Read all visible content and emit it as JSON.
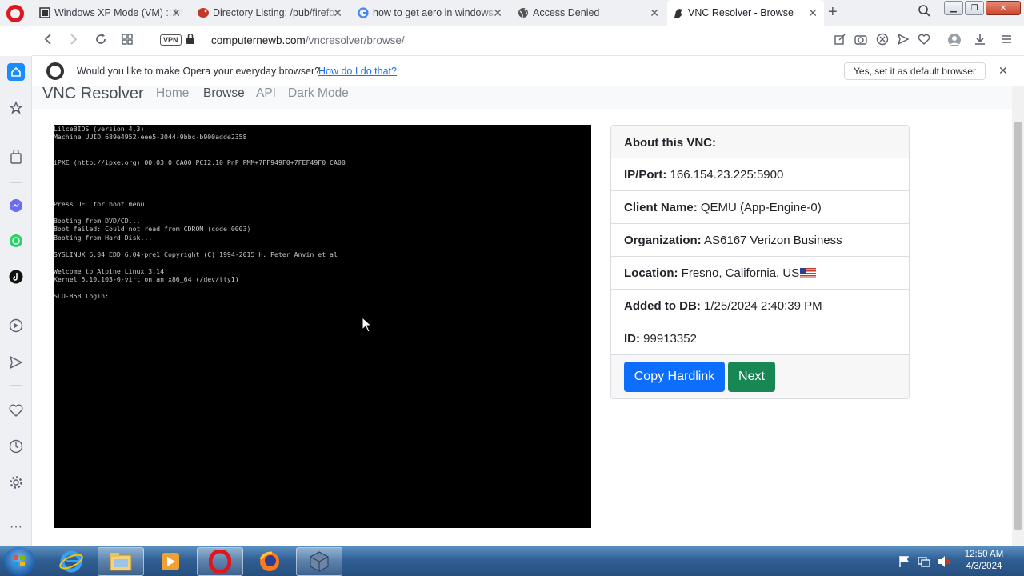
{
  "tabs": [
    {
      "title": "Windows XP Mode (VM) :: M",
      "icon": "window-icon"
    },
    {
      "title": "Directory Listing: /pub/firefox",
      "icon": "bird-icon"
    },
    {
      "title": "how to get aero in windows",
      "icon": "google-icon"
    },
    {
      "title": "Access Denied",
      "icon": "globe-icon"
    },
    {
      "title": "VNC Resolver - Browse",
      "icon": "dino-icon"
    }
  ],
  "address": {
    "vpn": "VPN",
    "domain": "computernewb.com",
    "path": "/vncresolver/browse/"
  },
  "default_bar": {
    "message": "Would you like to make Opera your everyday browser?",
    "link": "How do I do that?",
    "button": "Yes, set it as default browser"
  },
  "site_nav": {
    "brand": "VNC Resolver",
    "links": [
      "Home",
      "Browse",
      "API",
      "Dark Mode"
    ],
    "active": "Browse"
  },
  "terminal_lines": [
    "LilceBIOS (version 4.3)",
    "Machine UUID 689e4952-eee5-3044-9bbc-b900adde2358",
    "",
    "",
    "iPXE (http://ipxe.org) 00:03.0 CA00 PCI2.10 PnP PMM+7FF949F0+7FEF49F0 CA00",
    "",
    "",
    "",
    "",
    "Press DEL for boot menu.",
    "",
    "Booting from DVD/CD...",
    "Boot failed: Could not read from CDROM (code 0003)",
    "Booting from Hard Disk...",
    "",
    "SYSLINUX 6.04 EDD 6.04-pre1 Copyright (C) 1994-2015 H. Peter Anvin et al",
    "",
    "Welcome to Alpine Linux 3.14",
    "Kernel 5.10.103-0-virt on an x86_64 (/dev/tty1)",
    "",
    "SLO-85B login:"
  ],
  "vnc_info": {
    "heading": "About this VNC:",
    "rows": [
      {
        "label": "IP/Port:",
        "value": "166.154.23.225:5900"
      },
      {
        "label": "Client Name:",
        "value": "QEMU (App-Engine-0)"
      },
      {
        "label": "Organization:",
        "value": "AS6167 Verizon Business"
      },
      {
        "label": "Location:",
        "value": "Fresno, California, US"
      },
      {
        "label": "Added to DB:",
        "value": "1/25/2024 2:40:39 PM"
      },
      {
        "label": "ID:",
        "value": "99913352"
      }
    ],
    "copy_button": "Copy Hardlink",
    "next_button": "Next"
  },
  "taskbar": {
    "time": "12:50 AM",
    "date": "4/3/2024"
  },
  "colors": {
    "primary": "#0d6efd",
    "success": "#198754",
    "opera_red": "#e0161e"
  }
}
